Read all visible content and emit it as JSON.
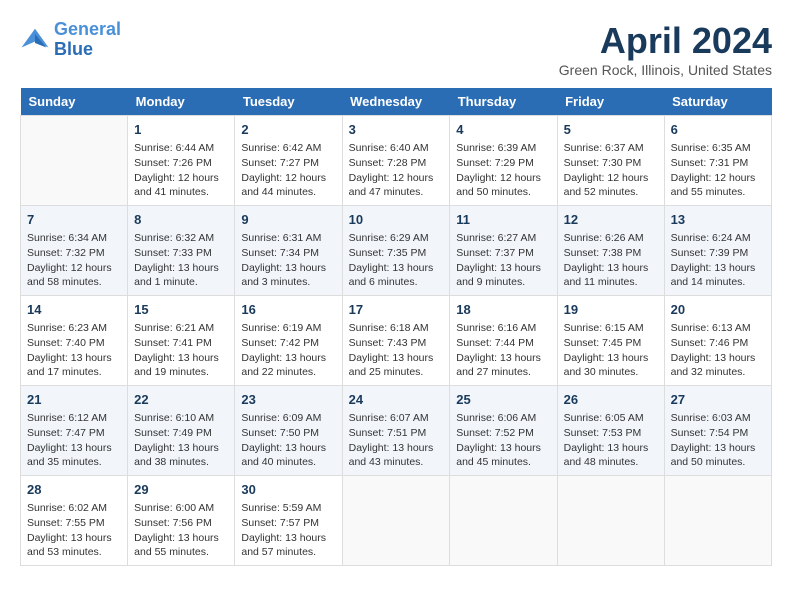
{
  "header": {
    "logo_line1": "General",
    "logo_line2": "Blue",
    "month": "April 2024",
    "location": "Green Rock, Illinois, United States"
  },
  "days_of_week": [
    "Sunday",
    "Monday",
    "Tuesday",
    "Wednesday",
    "Thursday",
    "Friday",
    "Saturday"
  ],
  "weeks": [
    [
      {
        "day": "",
        "sunrise": "",
        "sunset": "",
        "daylight": ""
      },
      {
        "day": "1",
        "sunrise": "Sunrise: 6:44 AM",
        "sunset": "Sunset: 7:26 PM",
        "daylight": "Daylight: 12 hours and 41 minutes."
      },
      {
        "day": "2",
        "sunrise": "Sunrise: 6:42 AM",
        "sunset": "Sunset: 7:27 PM",
        "daylight": "Daylight: 12 hours and 44 minutes."
      },
      {
        "day": "3",
        "sunrise": "Sunrise: 6:40 AM",
        "sunset": "Sunset: 7:28 PM",
        "daylight": "Daylight: 12 hours and 47 minutes."
      },
      {
        "day": "4",
        "sunrise": "Sunrise: 6:39 AM",
        "sunset": "Sunset: 7:29 PM",
        "daylight": "Daylight: 12 hours and 50 minutes."
      },
      {
        "day": "5",
        "sunrise": "Sunrise: 6:37 AM",
        "sunset": "Sunset: 7:30 PM",
        "daylight": "Daylight: 12 hours and 52 minutes."
      },
      {
        "day": "6",
        "sunrise": "Sunrise: 6:35 AM",
        "sunset": "Sunset: 7:31 PM",
        "daylight": "Daylight: 12 hours and 55 minutes."
      }
    ],
    [
      {
        "day": "7",
        "sunrise": "Sunrise: 6:34 AM",
        "sunset": "Sunset: 7:32 PM",
        "daylight": "Daylight: 12 hours and 58 minutes."
      },
      {
        "day": "8",
        "sunrise": "Sunrise: 6:32 AM",
        "sunset": "Sunset: 7:33 PM",
        "daylight": "Daylight: 13 hours and 1 minute."
      },
      {
        "day": "9",
        "sunrise": "Sunrise: 6:31 AM",
        "sunset": "Sunset: 7:34 PM",
        "daylight": "Daylight: 13 hours and 3 minutes."
      },
      {
        "day": "10",
        "sunrise": "Sunrise: 6:29 AM",
        "sunset": "Sunset: 7:35 PM",
        "daylight": "Daylight: 13 hours and 6 minutes."
      },
      {
        "day": "11",
        "sunrise": "Sunrise: 6:27 AM",
        "sunset": "Sunset: 7:37 PM",
        "daylight": "Daylight: 13 hours and 9 minutes."
      },
      {
        "day": "12",
        "sunrise": "Sunrise: 6:26 AM",
        "sunset": "Sunset: 7:38 PM",
        "daylight": "Daylight: 13 hours and 11 minutes."
      },
      {
        "day": "13",
        "sunrise": "Sunrise: 6:24 AM",
        "sunset": "Sunset: 7:39 PM",
        "daylight": "Daylight: 13 hours and 14 minutes."
      }
    ],
    [
      {
        "day": "14",
        "sunrise": "Sunrise: 6:23 AM",
        "sunset": "Sunset: 7:40 PM",
        "daylight": "Daylight: 13 hours and 17 minutes."
      },
      {
        "day": "15",
        "sunrise": "Sunrise: 6:21 AM",
        "sunset": "Sunset: 7:41 PM",
        "daylight": "Daylight: 13 hours and 19 minutes."
      },
      {
        "day": "16",
        "sunrise": "Sunrise: 6:19 AM",
        "sunset": "Sunset: 7:42 PM",
        "daylight": "Daylight: 13 hours and 22 minutes."
      },
      {
        "day": "17",
        "sunrise": "Sunrise: 6:18 AM",
        "sunset": "Sunset: 7:43 PM",
        "daylight": "Daylight: 13 hours and 25 minutes."
      },
      {
        "day": "18",
        "sunrise": "Sunrise: 6:16 AM",
        "sunset": "Sunset: 7:44 PM",
        "daylight": "Daylight: 13 hours and 27 minutes."
      },
      {
        "day": "19",
        "sunrise": "Sunrise: 6:15 AM",
        "sunset": "Sunset: 7:45 PM",
        "daylight": "Daylight: 13 hours and 30 minutes."
      },
      {
        "day": "20",
        "sunrise": "Sunrise: 6:13 AM",
        "sunset": "Sunset: 7:46 PM",
        "daylight": "Daylight: 13 hours and 32 minutes."
      }
    ],
    [
      {
        "day": "21",
        "sunrise": "Sunrise: 6:12 AM",
        "sunset": "Sunset: 7:47 PM",
        "daylight": "Daylight: 13 hours and 35 minutes."
      },
      {
        "day": "22",
        "sunrise": "Sunrise: 6:10 AM",
        "sunset": "Sunset: 7:49 PM",
        "daylight": "Daylight: 13 hours and 38 minutes."
      },
      {
        "day": "23",
        "sunrise": "Sunrise: 6:09 AM",
        "sunset": "Sunset: 7:50 PM",
        "daylight": "Daylight: 13 hours and 40 minutes."
      },
      {
        "day": "24",
        "sunrise": "Sunrise: 6:07 AM",
        "sunset": "Sunset: 7:51 PM",
        "daylight": "Daylight: 13 hours and 43 minutes."
      },
      {
        "day": "25",
        "sunrise": "Sunrise: 6:06 AM",
        "sunset": "Sunset: 7:52 PM",
        "daylight": "Daylight: 13 hours and 45 minutes."
      },
      {
        "day": "26",
        "sunrise": "Sunrise: 6:05 AM",
        "sunset": "Sunset: 7:53 PM",
        "daylight": "Daylight: 13 hours and 48 minutes."
      },
      {
        "day": "27",
        "sunrise": "Sunrise: 6:03 AM",
        "sunset": "Sunset: 7:54 PM",
        "daylight": "Daylight: 13 hours and 50 minutes."
      }
    ],
    [
      {
        "day": "28",
        "sunrise": "Sunrise: 6:02 AM",
        "sunset": "Sunset: 7:55 PM",
        "daylight": "Daylight: 13 hours and 53 minutes."
      },
      {
        "day": "29",
        "sunrise": "Sunrise: 6:00 AM",
        "sunset": "Sunset: 7:56 PM",
        "daylight": "Daylight: 13 hours and 55 minutes."
      },
      {
        "day": "30",
        "sunrise": "Sunrise: 5:59 AM",
        "sunset": "Sunset: 7:57 PM",
        "daylight": "Daylight: 13 hours and 57 minutes."
      },
      {
        "day": "",
        "sunrise": "",
        "sunset": "",
        "daylight": ""
      },
      {
        "day": "",
        "sunrise": "",
        "sunset": "",
        "daylight": ""
      },
      {
        "day": "",
        "sunrise": "",
        "sunset": "",
        "daylight": ""
      },
      {
        "day": "",
        "sunrise": "",
        "sunset": "",
        "daylight": ""
      }
    ]
  ]
}
